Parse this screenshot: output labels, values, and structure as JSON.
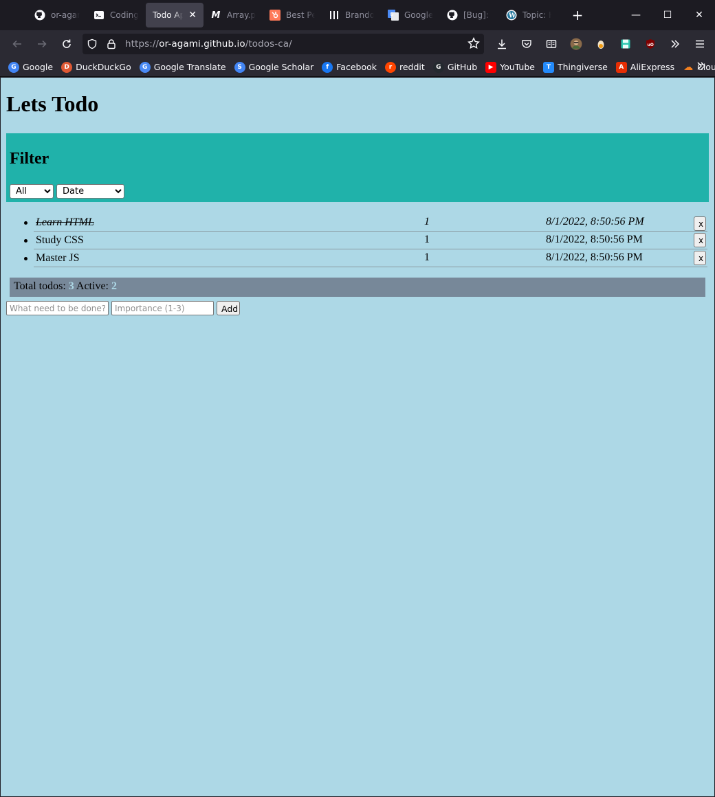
{
  "browser": {
    "tabs": [
      {
        "label": "or-agami",
        "icon": "github-icon",
        "active": false
      },
      {
        "label": "Coding",
        "icon": "terminal-icon",
        "active": false
      },
      {
        "label": "Todo App",
        "icon": "",
        "active": true
      },
      {
        "label": "Array.pr",
        "icon": "medium-icon",
        "active": false
      },
      {
        "label": "Best Per",
        "icon": "hubspot-icon",
        "active": false
      },
      {
        "label": "Brandon",
        "icon": "bars-icon",
        "active": false
      },
      {
        "label": "Google",
        "icon": "google-translate-icon",
        "active": false
      },
      {
        "label": "[Bug]: S",
        "icon": "github-icon",
        "active": false
      },
      {
        "label": "Topic: H",
        "icon": "wordpress-icon",
        "active": false
      }
    ],
    "url": {
      "prefix": "https://",
      "host": "or-agami.github.io",
      "path": "/todos-ca/"
    },
    "bookmarks": [
      {
        "label": "Google",
        "color": "#4285f4",
        "glyph": "G"
      },
      {
        "label": "DuckDuckGo",
        "color": "#de5833",
        "glyph": "D"
      },
      {
        "label": "Google Translate",
        "color": "#4a8af4",
        "glyph": "G"
      },
      {
        "label": "Google Scholar",
        "color": "#4285f4",
        "glyph": "S"
      },
      {
        "label": "Facebook",
        "color": "#1877f2",
        "glyph": "f"
      },
      {
        "label": "reddit",
        "color": "#ff4500",
        "glyph": "r"
      },
      {
        "label": "GitHub",
        "color": "#24292f",
        "glyph": "G"
      },
      {
        "label": "YouTube",
        "color": "#ff0000",
        "glyph": "▶"
      },
      {
        "label": "Thingiverse",
        "color": "#248bfb",
        "glyph": "T"
      },
      {
        "label": "AliExpress",
        "color": "#e62e04",
        "glyph": "A"
      },
      {
        "label": "Cloudflare",
        "color": "#f38020",
        "glyph": "☁"
      }
    ]
  },
  "app": {
    "title": "Lets Todo",
    "filter": {
      "heading": "Filter",
      "status_value": "All",
      "sort_value": "Date"
    },
    "todos": [
      {
        "text": "Learn HTML",
        "importance": "1",
        "date": "8/1/2022, 8:50:56 PM",
        "done": true,
        "delete_label": "x"
      },
      {
        "text": "Study CSS",
        "importance": "1",
        "date": "8/1/2022, 8:50:56 PM",
        "done": false,
        "delete_label": "x"
      },
      {
        "text": "Master JS",
        "importance": "1",
        "date": "8/1/2022, 8:50:56 PM",
        "done": false,
        "delete_label": "x"
      }
    ],
    "stats": {
      "total_label": "Total todos:",
      "total": "3",
      "active_label": "Active:",
      "active": "2"
    },
    "add_form": {
      "text_placeholder": "What need to be done?",
      "importance_placeholder": "Importance (1-3)",
      "add_label": "Add"
    }
  }
}
